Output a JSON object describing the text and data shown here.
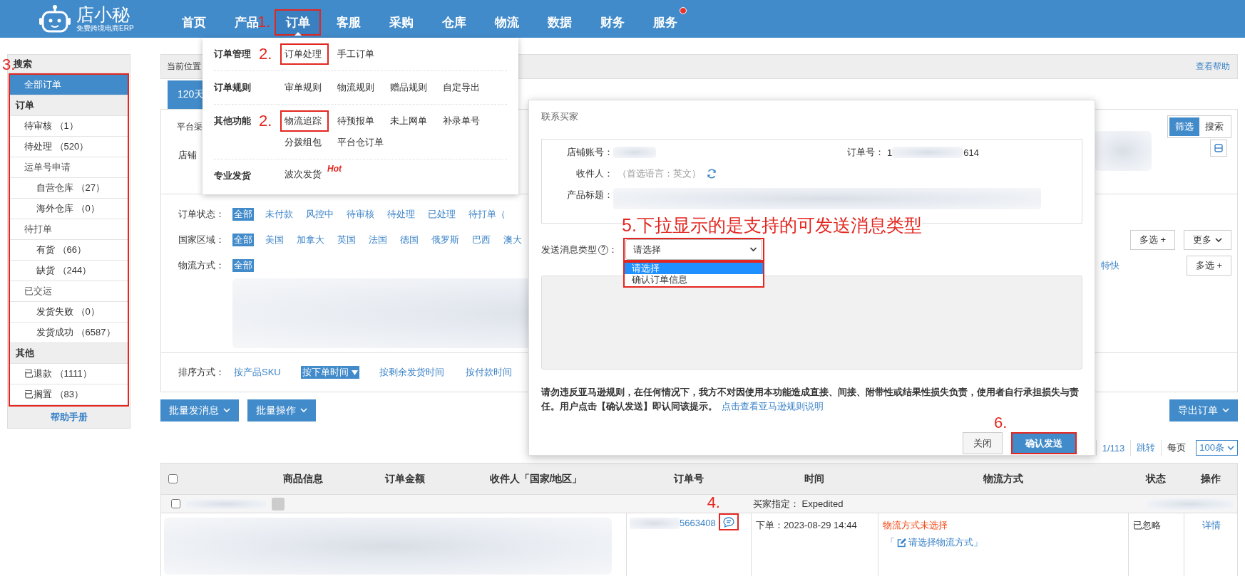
{
  "topbar": {
    "logo_title": "店小秘",
    "logo_subtitle": "免费跨境电商ERP",
    "nav": [
      {
        "label": "首页",
        "selected": false,
        "highlighted": false,
        "badge": false
      },
      {
        "label": "产品",
        "selected": false,
        "highlighted": false,
        "badge": false
      },
      {
        "label": "订单",
        "selected": true,
        "highlighted": true,
        "step": "1.",
        "badge": false
      },
      {
        "label": "客服",
        "selected": false,
        "highlighted": false,
        "badge": false
      },
      {
        "label": "采购",
        "selected": false,
        "highlighted": false,
        "badge": false
      },
      {
        "label": "仓库",
        "selected": false,
        "highlighted": false,
        "badge": false
      },
      {
        "label": "物流",
        "selected": false,
        "highlighted": false,
        "badge": false
      },
      {
        "label": "数据",
        "selected": false,
        "highlighted": false,
        "badge": false
      },
      {
        "label": "财务",
        "selected": false,
        "highlighted": false,
        "badge": false
      },
      {
        "label": "服务",
        "selected": false,
        "highlighted": false,
        "badge": true
      }
    ]
  },
  "order_menu": {
    "groups": [
      {
        "title": "订单管理",
        "lines": [
          [
            {
              "label": "订单处理",
              "highlighted": true,
              "step": "2."
            },
            {
              "label": "手工订单",
              "highlighted": false
            }
          ]
        ]
      },
      {
        "title": "订单规则",
        "lines": [
          [
            {
              "label": "审单规则",
              "highlighted": false
            },
            {
              "label": "物流规则",
              "highlighted": false
            },
            {
              "label": "赠品规则",
              "highlighted": false
            },
            {
              "label": "自定导出",
              "highlighted": false
            }
          ]
        ]
      },
      {
        "title": "其他功能",
        "lines": [
          [
            {
              "label": "物流追踪",
              "highlighted": true,
              "step": "2."
            },
            {
              "label": "待预报单",
              "highlighted": false
            },
            {
              "label": "未上网单",
              "highlighted": false
            },
            {
              "label": "补录单号",
              "highlighted": false
            }
          ],
          [
            {
              "label": "分拨组包",
              "highlighted": false
            },
            {
              "label": "平台仓订单",
              "highlighted": false
            }
          ]
        ]
      },
      {
        "title": "专业发货",
        "lines": [
          [
            {
              "label": "波次发货",
              "highlighted": false,
              "tag": "Hot"
            }
          ]
        ]
      }
    ]
  },
  "sidebar": {
    "heading": "搜索",
    "highlighted": true,
    "step": "3.",
    "footer": "帮助手册",
    "items": [
      {
        "kind": "link",
        "label": "全部订单",
        "selected": true
      },
      {
        "kind": "header",
        "label": "订单"
      },
      {
        "kind": "link",
        "label": "待审核 （1）",
        "selected": false
      },
      {
        "kind": "link",
        "label": "待处理 （520）",
        "selected": false
      },
      {
        "kind": "group",
        "label": "运单号申请",
        "selected": false,
        "children": [
          {
            "label": "自营仓库 （27）",
            "selected": false
          },
          {
            "label": "海外仓库 （0）",
            "selected": false
          }
        ]
      },
      {
        "kind": "group",
        "label": "待打单",
        "selected": false,
        "children": [
          {
            "label": "有货 （66）",
            "selected": false
          },
          {
            "label": "缺货 （244）",
            "selected": false
          }
        ]
      },
      {
        "kind": "group",
        "label": "已交运",
        "selected": false,
        "children": [
          {
            "label": "发货失败 （0）",
            "selected": false
          },
          {
            "label": "发货成功 （6587）",
            "selected": false
          }
        ]
      },
      {
        "kind": "header",
        "label": "其他"
      },
      {
        "kind": "link",
        "label": "已退款 （1111）",
        "selected": false
      },
      {
        "kind": "link",
        "label": "已搁置 （83）",
        "selected": false
      }
    ]
  },
  "main": {
    "breadcrumb": "当前位置",
    "help": "查看帮助",
    "tabs": [
      {
        "label": "120天",
        "selected": true
      }
    ],
    "platform_label": "平台渠",
    "store_label": "店铺",
    "view_toggle": [
      {
        "label": "筛选",
        "selected": true
      },
      {
        "label": "搜索",
        "selected": false
      }
    ],
    "filters": [
      {
        "label": "订单状态：",
        "options": [
          {
            "label": "全部",
            "selected": true
          },
          {
            "label": "未付款",
            "selected": false
          },
          {
            "label": "风控中",
            "selected": false
          },
          {
            "label": "待审核",
            "selected": false
          },
          {
            "label": "待处理",
            "selected": false
          },
          {
            "label": "已处理",
            "selected": false
          },
          {
            "label": "待打单（",
            "selected": false
          }
        ]
      },
      {
        "label": "国家区域：",
        "options": [
          {
            "label": "全部",
            "selected": true
          },
          {
            "label": "美国",
            "selected": false
          },
          {
            "label": "加拿大",
            "selected": false
          },
          {
            "label": "英国",
            "selected": false
          },
          {
            "label": "法国",
            "selected": false
          },
          {
            "label": "德国",
            "selected": false
          },
          {
            "label": "俄罗斯",
            "selected": false
          },
          {
            "label": "巴西",
            "selected": false
          },
          {
            "label": "澳大",
            "selected": false
          }
        ],
        "extras": [
          {
            "kind": "button",
            "label": "多选 +"
          },
          {
            "kind": "dropdown",
            "label": "更多"
          }
        ]
      },
      {
        "label": "物流方式：",
        "options": [
          {
            "label": "全部",
            "selected": true
          }
        ],
        "extras": [
          {
            "kind": "text",
            "label": "特快"
          },
          {
            "kind": "button",
            "label": "多选 +"
          }
        ]
      }
    ],
    "sort": {
      "label": "排序方式：",
      "options": [
        {
          "label": "按产品SKU",
          "selected": false
        },
        {
          "label": "按下单时间",
          "selected": true
        },
        {
          "label": "按剩余发货时间",
          "selected": false
        },
        {
          "label": "按付款时间",
          "selected": false
        }
      ]
    },
    "actions": [
      "批量发消息",
      "批量操作"
    ],
    "export": "导出订单",
    "pagination": {
      "page": "1/113",
      "jump": "跳转",
      "per_page_label": "每页",
      "per_page": "100条"
    },
    "table": {
      "select_all_checked": false,
      "columns": [
        "商品信息",
        "订单金额",
        "收件人「国家/地区」",
        "订单号",
        "时间",
        "物流方式",
        "状态",
        "操作"
      ],
      "group": {
        "checked": false,
        "buyer_choice": "买家指定： Expedited"
      },
      "rows": [
        {
          "order_no": "5663408",
          "message_highlighted": true,
          "step": "4.",
          "time": "下单：2023-08-29 14:44",
          "shipping_status": "物流方式未选择",
          "shipping_action": "「请选择物流方式」",
          "status": "已忽略",
          "action": "详情"
        }
      ]
    }
  },
  "modal": {
    "title": "联系买家",
    "info": [
      {
        "kind": "blurred",
        "label": "店铺账号："
      },
      {
        "kind": "masked",
        "label": "订单号：",
        "head": "1",
        "tail": "614"
      },
      {
        "kind": "hint",
        "label": "收件人：",
        "hint": "（首选语言：英文）"
      },
      {
        "kind": "blurred_wide",
        "label": "产品标题："
      }
    ],
    "annotation": "5.下拉显示的是支持的可发送消息类型",
    "message_type": {
      "label": "发送消息类型",
      "help": "?",
      "colon": "：",
      "value": "请选择",
      "expanded": true,
      "highlighted": true,
      "options": [
        {
          "label": "请选择",
          "selected": true
        },
        {
          "label": "确认订单信息",
          "selected": false
        }
      ]
    },
    "notice": "请勿违反亚马逊规则，在任何情况下，我方不对因使用本功能造成直接、间接、附带性或结果性损失负责，使用者自行承担损失与责任。用户点击【确认发送】即认同该提示。",
    "notice_link": "点击查看亚马逊规则说明",
    "buttons": [
      {
        "kind": "secondary",
        "label": "关闭",
        "highlighted": false
      },
      {
        "kind": "primary",
        "label": "确认发送",
        "highlighted": true,
        "step": "6."
      }
    ]
  }
}
